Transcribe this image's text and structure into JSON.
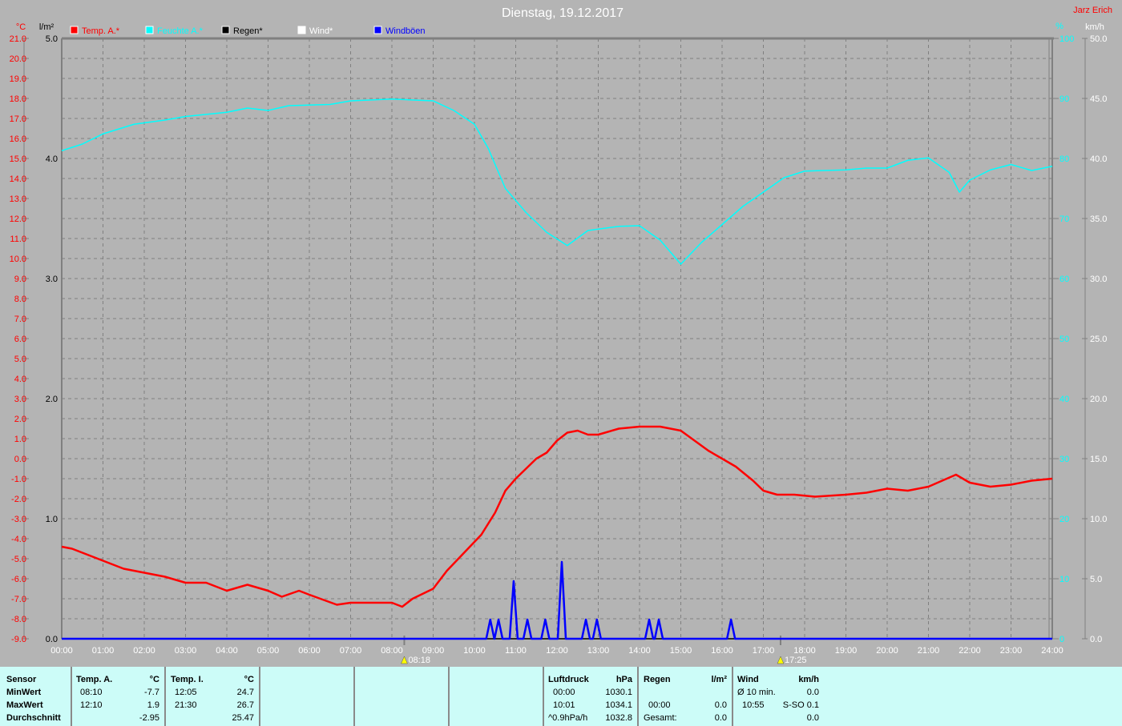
{
  "title": "Dienstag, 19.12.2017",
  "author": "Jarz Erich",
  "colors": {
    "background": "#b4b4b4",
    "temp": "#ff0000",
    "humidity": "#00ffff",
    "rain": "#000000",
    "wind": "#ffffff",
    "gusts": "#0000ff",
    "table": "#ccfcf8"
  },
  "legend": [
    {
      "label": "Temp. A.*",
      "color": "#ff0000"
    },
    {
      "label": "Feuchte A.*",
      "color": "#00ffff"
    },
    {
      "label": "Regen*",
      "color": "#000000"
    },
    {
      "label": "Wind*",
      "color": "#ffffff"
    },
    {
      "label": "Windböen",
      "color": "#0000ff"
    }
  ],
  "chart_data": {
    "type": "line",
    "title": "Dienstag, 19.12.2017",
    "grid": true,
    "legend_placement": "top-left",
    "x_ticks": [
      "00:00",
      "01:00",
      "02:00",
      "03:00",
      "04:00",
      "05:00",
      "06:00",
      "07:00",
      "08:00",
      "09:00",
      "10:00",
      "11:00",
      "12:00",
      "13:00",
      "14:00",
      "15:00",
      "16:00",
      "17:00",
      "18:00",
      "19:00",
      "20:00",
      "21:00",
      "22:00",
      "23:00",
      "24:00"
    ],
    "axes": {
      "temp": {
        "unit": "°C",
        "range": [
          -9,
          21
        ],
        "ticks": [
          "21.0",
          "20.0",
          "19.0",
          "18.0",
          "17.0",
          "16.0",
          "15.0",
          "14.0",
          "13.0",
          "12.0",
          "11.0",
          "10.0",
          "9.0",
          "8.0",
          "7.0",
          "6.0",
          "5.0",
          "4.0",
          "3.0",
          "2.0",
          "1.0",
          "0.0",
          "-1.0",
          "-2.0",
          "-3.0",
          "-4.0",
          "-5.0",
          "-6.0",
          "-7.0",
          "-8.0",
          "-9.0"
        ]
      },
      "rain": {
        "unit": "l/m²",
        "range": [
          0,
          5
        ],
        "ticks": [
          "5.0",
          "4.0",
          "3.0",
          "2.0",
          "1.0",
          "0.0"
        ]
      },
      "humidity": {
        "unit": "%",
        "range": [
          0,
          100
        ],
        "ticks": [
          "100",
          "90",
          "80",
          "70",
          "60",
          "50",
          "40",
          "30",
          "20",
          "10",
          "0"
        ]
      },
      "wind": {
        "unit": "km/h",
        "range": [
          0,
          50
        ],
        "ticks": [
          "50.0",
          "45.0",
          "40.0",
          "35.0",
          "30.0",
          "25.0",
          "20.0",
          "15.0",
          "10.0",
          "5.0",
          "0.0"
        ]
      }
    },
    "markers": [
      {
        "icon": "sunrise-icon",
        "time": "08:18"
      },
      {
        "icon": "sunset-icon",
        "time": "17:25"
      }
    ],
    "series": [
      {
        "name": "Temp. A.*",
        "axis": "temp",
        "color": "#ff0000",
        "points": [
          [
            "00:00",
            -4.4
          ],
          [
            "00:15",
            -4.5
          ],
          [
            "01:00",
            -5.1
          ],
          [
            "01:30",
            -5.5
          ],
          [
            "02:00",
            -5.7
          ],
          [
            "02:30",
            -5.9
          ],
          [
            "03:00",
            -6.2
          ],
          [
            "03:30",
            -6.2
          ],
          [
            "04:00",
            -6.6
          ],
          [
            "04:30",
            -6.3
          ],
          [
            "05:00",
            -6.6
          ],
          [
            "05:20",
            -6.9
          ],
          [
            "05:45",
            -6.6
          ],
          [
            "06:00",
            -6.8
          ],
          [
            "06:40",
            -7.3
          ],
          [
            "07:00",
            -7.2
          ],
          [
            "07:30",
            -7.2
          ],
          [
            "08:00",
            -7.2
          ],
          [
            "08:15",
            -7.4
          ],
          [
            "08:30",
            -7.0
          ],
          [
            "09:00",
            -6.5
          ],
          [
            "09:20",
            -5.6
          ],
          [
            "09:45",
            -4.7
          ],
          [
            "10:10",
            -3.8
          ],
          [
            "10:30",
            -2.7
          ],
          [
            "10:45",
            -1.6
          ],
          [
            "11:00",
            -1.0
          ],
          [
            "11:30",
            0.0
          ],
          [
            "11:45",
            0.3
          ],
          [
            "12:00",
            0.9
          ],
          [
            "12:15",
            1.3
          ],
          [
            "12:30",
            1.4
          ],
          [
            "12:45",
            1.2
          ],
          [
            "13:00",
            1.2
          ],
          [
            "13:30",
            1.5
          ],
          [
            "14:00",
            1.6
          ],
          [
            "14:30",
            1.6
          ],
          [
            "15:00",
            1.4
          ],
          [
            "15:20",
            0.9
          ],
          [
            "15:40",
            0.4
          ],
          [
            "16:00",
            0.0
          ],
          [
            "16:20",
            -0.4
          ],
          [
            "16:45",
            -1.1
          ],
          [
            "17:00",
            -1.6
          ],
          [
            "17:20",
            -1.8
          ],
          [
            "17:45",
            -1.8
          ],
          [
            "18:15",
            -1.9
          ],
          [
            "19:00",
            -1.8
          ],
          [
            "19:30",
            -1.7
          ],
          [
            "20:00",
            -1.5
          ],
          [
            "20:30",
            -1.6
          ],
          [
            "21:00",
            -1.4
          ],
          [
            "21:40",
            -0.8
          ],
          [
            "22:00",
            -1.2
          ],
          [
            "22:30",
            -1.4
          ],
          [
            "23:00",
            -1.3
          ],
          [
            "23:30",
            -1.1
          ],
          [
            "24:00",
            -1.0
          ]
        ]
      },
      {
        "name": "Feuchte A.*",
        "axis": "humidity",
        "color": "#00ffff",
        "points": [
          [
            "00:00",
            81.3
          ],
          [
            "00:30",
            82.4
          ],
          [
            "01:00",
            84.1
          ],
          [
            "01:45",
            85.7
          ],
          [
            "02:30",
            86.4
          ],
          [
            "03:00",
            87.0
          ],
          [
            "04:00",
            87.7
          ],
          [
            "04:30",
            88.4
          ],
          [
            "05:00",
            88.0
          ],
          [
            "05:30",
            88.8
          ],
          [
            "06:30",
            89.0
          ],
          [
            "07:00",
            89.6
          ],
          [
            "08:00",
            89.9
          ],
          [
            "09:00",
            89.6
          ],
          [
            "09:30",
            88.0
          ],
          [
            "10:00",
            85.7
          ],
          [
            "10:20",
            81.7
          ],
          [
            "10:45",
            75.0
          ],
          [
            "11:15",
            71.0
          ],
          [
            "11:45",
            67.7
          ],
          [
            "12:15",
            65.5
          ],
          [
            "12:45",
            68.0
          ],
          [
            "13:30",
            68.7
          ],
          [
            "14:00",
            68.8
          ],
          [
            "14:30",
            66.4
          ],
          [
            "15:00",
            62.4
          ],
          [
            "15:30",
            66.0
          ],
          [
            "16:00",
            69.0
          ],
          [
            "16:30",
            72.0
          ],
          [
            "17:00",
            74.4
          ],
          [
            "17:30",
            76.8
          ],
          [
            "18:00",
            77.9
          ],
          [
            "19:00",
            78.1
          ],
          [
            "19:30",
            78.4
          ],
          [
            "20:00",
            78.4
          ],
          [
            "20:30",
            79.7
          ],
          [
            "21:00",
            80.1
          ],
          [
            "21:30",
            77.7
          ],
          [
            "21:45",
            74.4
          ],
          [
            "22:00",
            76.4
          ],
          [
            "22:30",
            78.1
          ],
          [
            "23:00",
            79.0
          ],
          [
            "23:30",
            78.0
          ],
          [
            "24:00",
            78.7
          ]
        ]
      },
      {
        "name": "Regen*",
        "axis": "rain",
        "color": "#000000",
        "points": [
          [
            "00:00",
            0.0
          ],
          [
            "24:00",
            0.0
          ]
        ]
      },
      {
        "name": "Windböen",
        "axis": "wind",
        "color": "#0000ff",
        "peaks": [
          [
            "10:23",
            1.6
          ],
          [
            "10:35",
            1.6
          ],
          [
            "10:57",
            4.8
          ],
          [
            "11:17",
            1.6
          ],
          [
            "11:43",
            1.6
          ],
          [
            "12:07",
            6.4
          ],
          [
            "12:42",
            1.6
          ],
          [
            "12:58",
            1.6
          ],
          [
            "14:14",
            1.6
          ],
          [
            "14:28",
            1.6
          ],
          [
            "16:13",
            1.6
          ]
        ]
      }
    ]
  },
  "table": {
    "sensor": {
      "header": "Sensor",
      "rows": [
        "MinWert",
        "MaxWert",
        "Durchschnitt"
      ]
    },
    "temp_a": {
      "header": "Temp. A.",
      "unit": "°C",
      "min_time": "08:10",
      "min": "-7.7",
      "max_time": "12:10",
      "max": "1.9",
      "avg": "-2.95"
    },
    "temp_i": {
      "header": "Temp. I.",
      "unit": "°C",
      "min_time": "12:05",
      "min": "24.7",
      "max_time": "21:30",
      "max": "26.7",
      "avg": "25.47"
    },
    "pressure": {
      "header": "Luftdruck",
      "unit": "hPa",
      "r1_label": "00:00",
      "r1": "1030.1",
      "r2_label": "10:01",
      "r2": "1034.1",
      "r3_label": "^0.9hPa/h",
      "r3": "1032.8"
    },
    "rain": {
      "header": "Regen",
      "unit": "l/m²",
      "r2_label": "00:00",
      "r2": "0.0",
      "r3_label": "Gesamt:",
      "r3": "0.0"
    },
    "wind": {
      "header": "Wind",
      "unit": "km/h",
      "r1_label": "Ø 10 min.",
      "r1": "0.0",
      "r2_label": "10:55",
      "r2": "S-SO 0.1",
      "r3": "0.0"
    }
  }
}
